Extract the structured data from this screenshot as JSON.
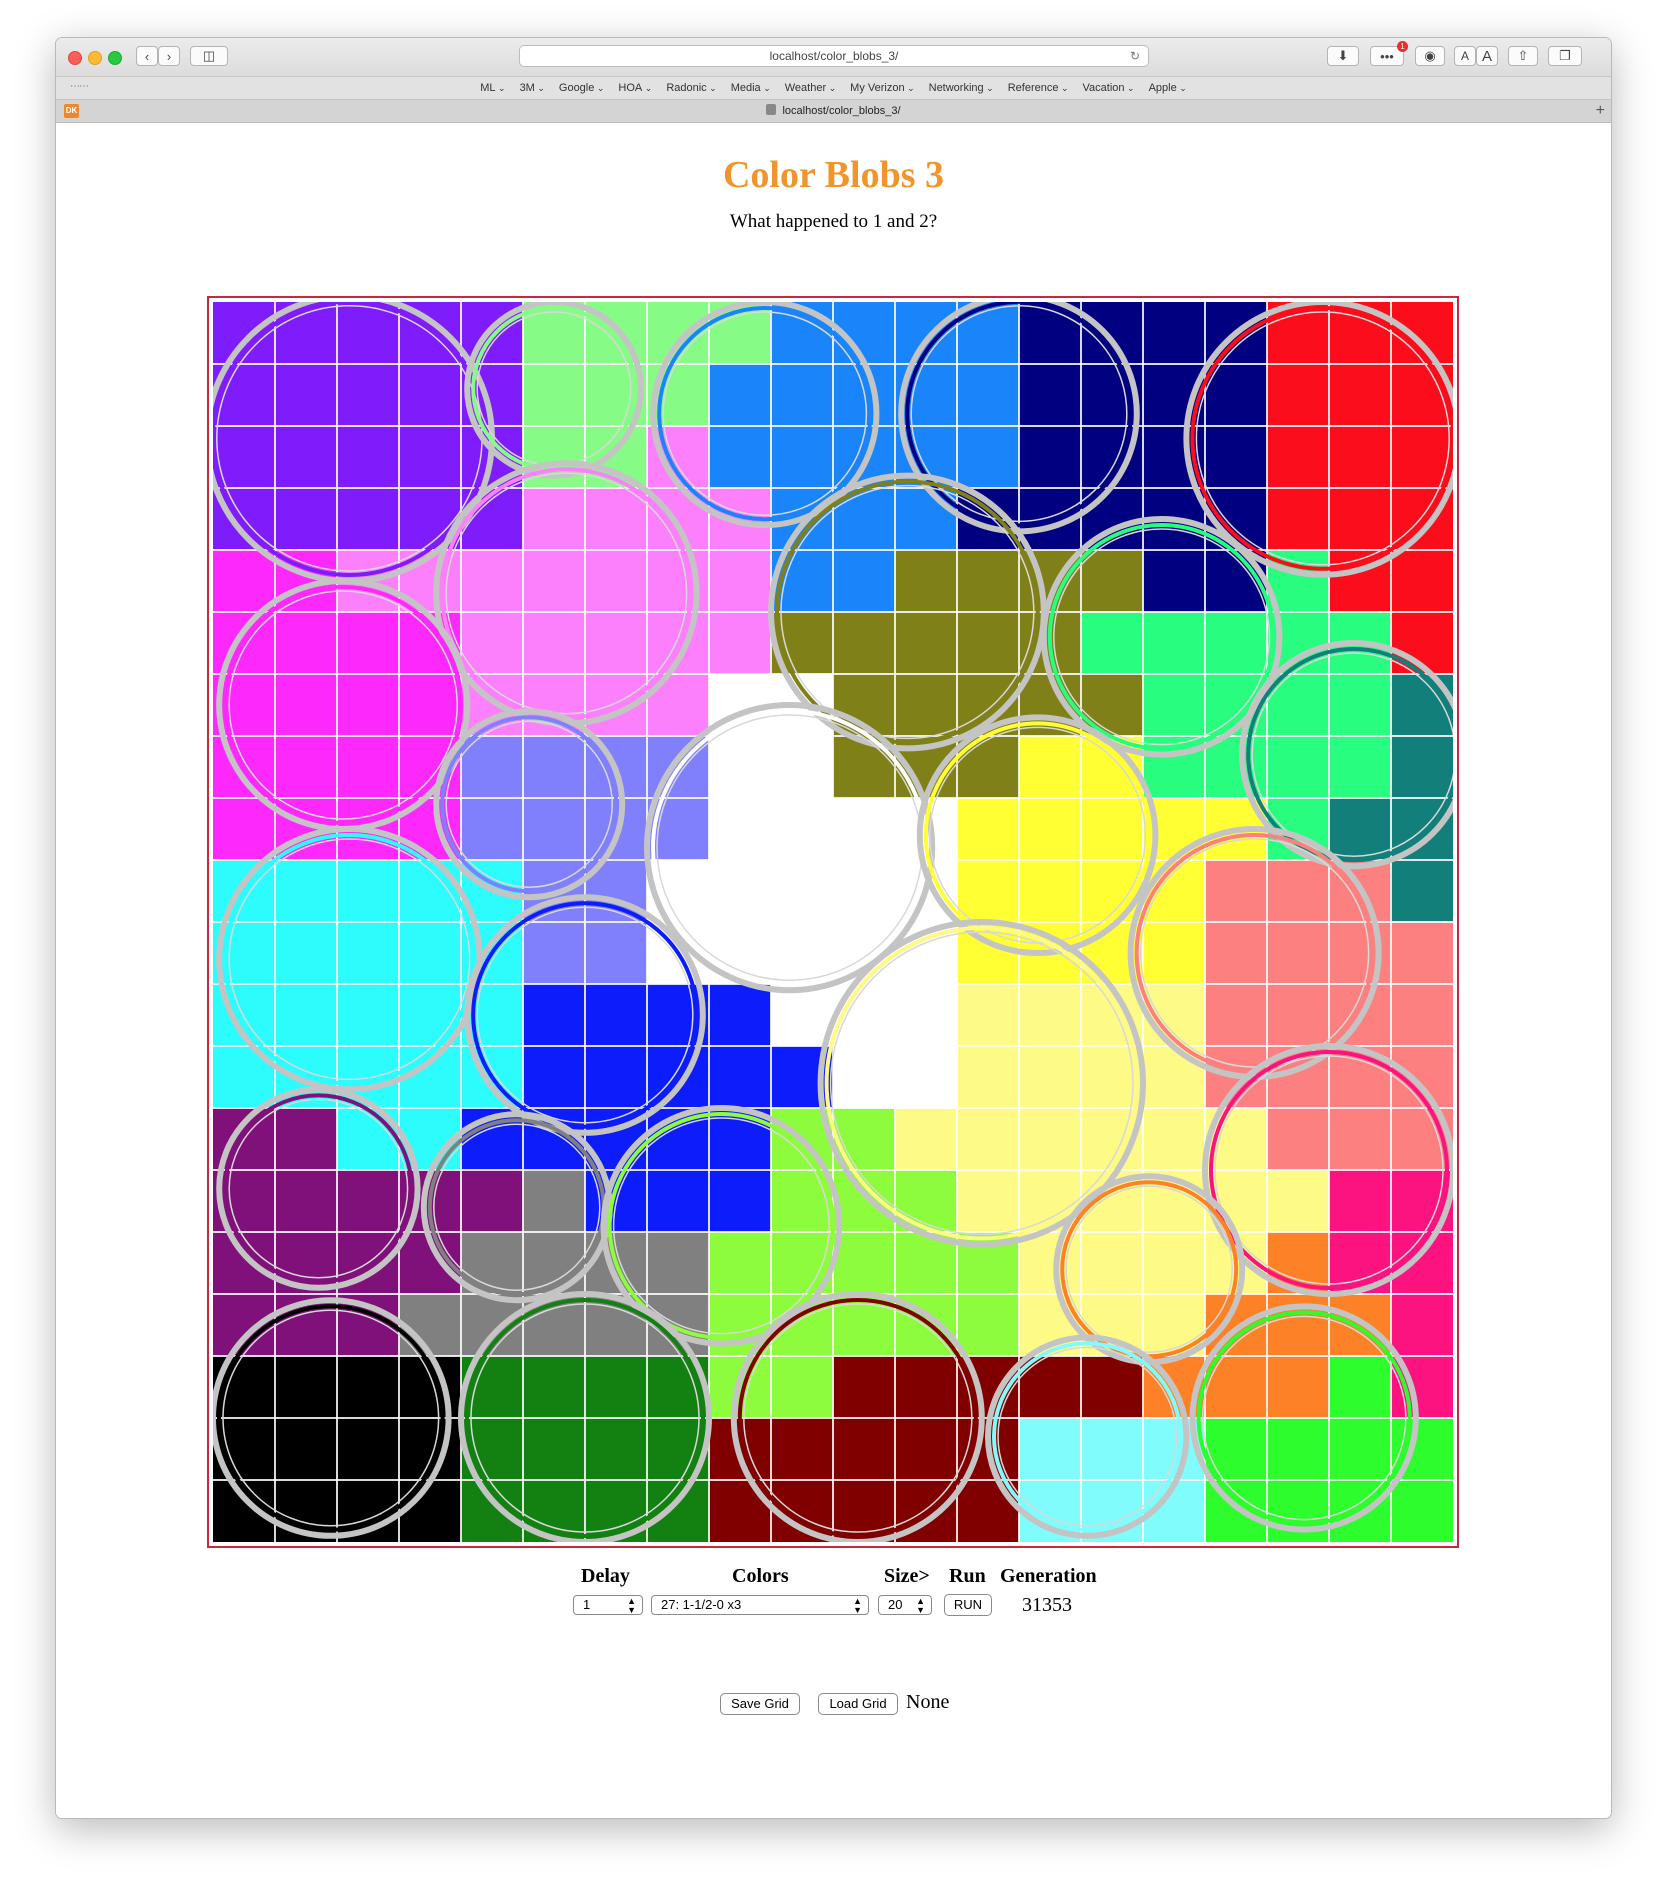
{
  "browser": {
    "url": "localhost/color_blobs_3/",
    "tab_title": "localhost/color_blobs_3/",
    "bookmarks": [
      "ML",
      "3M",
      "Google",
      "HOA",
      "Radonic",
      "Media",
      "Weather",
      "My Verizon",
      "Networking",
      "Reference",
      "Vacation",
      "Apple"
    ],
    "extension_label": "DK",
    "notification_badge": "1",
    "font_small": "A",
    "font_large": "A"
  },
  "page": {
    "title": "Color Blobs 3",
    "subtitle": "What happened to 1 and 2?"
  },
  "grid": {
    "cols": 20,
    "rows": 20,
    "border_color": "#c8283c",
    "palette": {
      "P": "#7f1cfb",
      "L": "#86fc86",
      "B": "#1a84fb",
      "N": "#000080",
      "R": "#fc0d1b",
      "K": "#fc80fc",
      "M": "#fc28fc",
      "O": "#808019",
      "G": "#29fd80",
      "T": "#137f7a",
      "V": "#8080fc",
      "W": "#ffffff",
      "Y": "#ffff33",
      "C": "#2dfcfd",
      "S": "#fc8080",
      "U": "#0c1cfb",
      "E": "#fefa86",
      "X": "#80117a",
      "A": "#808080",
      "H": "#8cfc3c",
      "Q": "#fc137f",
      "Z": "#000000",
      "D": "#138012",
      "F": "#800000",
      "J": "#fd8227",
      "I": "#80fcfc",
      "Ga": "#2dfc2d"
    },
    "cells": [
      "PPPPPLLLLBBBBNNNNRRRRR",
      "PPPPPLLLBBBBBNNNNRRRRR",
      "PPPPPLLKBBBBBNNNNRRRRR",
      "PPPPPKKKKBBBNNNNNRRRRR",
      "MMKKKKKKKBBOOOONNGRRRR",
      "MMMMKKKKKOOOOOGGGGGRRRR",
      "MMMMKKKKWWOOOOOGGGGTTT",
      "MMMMVVVVWWOOOYYGGGGTTT",
      "MMMMVVVVWWWWYYYYYGTTTT",
      "CCCCCVVWWWWWYYYYSSSTTT",
      "CCCCCVVWWWWWYYYYSSSSTT",
      "CCCCCUUUUWWWEEEESSSSSS",
      "CCCCCUUUUUWWEEEESSSSSS",
      "XXCCUUUUUHHEEEEEESSSQQQ",
      "XXXXXAUUUHHHEEEEEEQQQQ",
      "XXXXAAAAHHHHHEEEEJQQQQ",
      "XXXAAAAAHHHHHEEEJJJQQQ",
      "ZZZZDDDDHHFFFFFJJJGaQQ",
      "ZZZZDDDDFFFFFIIIGaGaGaGa",
      "ZZZZDDDDFFFFFIIIGaGaGaGa"
    ],
    "blobs": [
      {
        "c": "P",
        "x": 2.2,
        "y": 2.2,
        "r": 2.3
      },
      {
        "c": "L",
        "x": 5.5,
        "y": 1.4,
        "r": 1.4
      },
      {
        "c": "B",
        "x": 8.9,
        "y": 1.8,
        "r": 1.8
      },
      {
        "c": "N",
        "x": 13.0,
        "y": 1.8,
        "r": 1.9
      },
      {
        "c": "R",
        "x": 17.9,
        "y": 2.2,
        "r": 2.2
      },
      {
        "c": "K",
        "x": 5.7,
        "y": 4.7,
        "r": 2.1
      },
      {
        "c": "O",
        "x": 11.2,
        "y": 5.0,
        "r": 2.2
      },
      {
        "c": "G",
        "x": 15.3,
        "y": 5.4,
        "r": 1.9
      },
      {
        "c": "M",
        "x": 2.1,
        "y": 6.5,
        "r": 2.0
      },
      {
        "c": "T",
        "x": 18.4,
        "y": 7.3,
        "r": 1.8
      },
      {
        "c": "V",
        "x": 5.1,
        "y": 8.1,
        "r": 1.5
      },
      {
        "c": "W",
        "x": 9.3,
        "y": 8.8,
        "r": 2.3
      },
      {
        "c": "Y",
        "x": 13.3,
        "y": 8.6,
        "r": 1.9
      },
      {
        "c": "C",
        "x": 2.2,
        "y": 10.6,
        "r": 2.1
      },
      {
        "c": "S",
        "x": 16.8,
        "y": 10.5,
        "r": 2.0
      },
      {
        "c": "U",
        "x": 6.0,
        "y": 11.5,
        "r": 1.9
      },
      {
        "c": "E",
        "x": 12.4,
        "y": 12.6,
        "r": 2.6
      },
      {
        "c": "Q",
        "x": 18.0,
        "y": 14.0,
        "r": 2.0
      },
      {
        "c": "X",
        "x": 1.7,
        "y": 14.3,
        "r": 1.6
      },
      {
        "c": "A",
        "x": 4.9,
        "y": 14.6,
        "r": 1.5
      },
      {
        "c": "H",
        "x": 8.2,
        "y": 14.9,
        "r": 1.9
      },
      {
        "c": "J",
        "x": 15.1,
        "y": 15.6,
        "r": 1.5
      },
      {
        "c": "Z",
        "x": 1.9,
        "y": 18.0,
        "r": 1.9
      },
      {
        "c": "D",
        "x": 6.0,
        "y": 18.0,
        "r": 2.0
      },
      {
        "c": "F",
        "x": 10.4,
        "y": 18.0,
        "r": 2.0
      },
      {
        "c": "I",
        "x": 14.1,
        "y": 18.3,
        "r": 1.6
      },
      {
        "c": "Ga",
        "x": 17.6,
        "y": 18.0,
        "r": 1.8
      }
    ]
  },
  "controls": {
    "delay_label": "Delay",
    "colors_label": "Colors",
    "size_label": "Size>",
    "run_label": "Run",
    "generation_label": "Generation",
    "delay_value": "1",
    "colors_value": "27: 1-1/2-0 x3",
    "size_value": "20",
    "run_button": "RUN",
    "generation_value": "31353"
  },
  "storage": {
    "save_button": "Save Grid",
    "load_button": "Load Grid",
    "status": "None"
  }
}
